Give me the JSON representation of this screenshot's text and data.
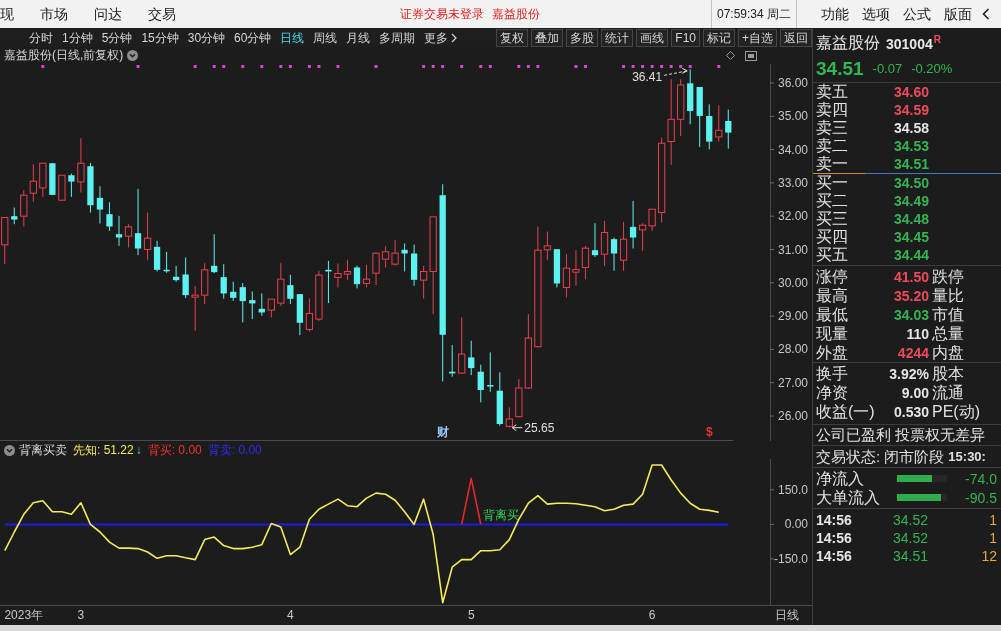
{
  "top_bar": {
    "menu": [
      "现",
      "市场",
      "问达",
      "交易"
    ],
    "notice": "证券交易未登录",
    "stock": "嘉益股份",
    "clock": "07:59:34 周二",
    "actions": [
      "功能",
      "选项",
      "公式",
      "版面"
    ]
  },
  "toolbar": {
    "period_tabs": [
      {
        "label": "分时",
        "selected": false
      },
      {
        "label": "1分钟",
        "selected": false
      },
      {
        "label": "5分钟",
        "selected": false
      },
      {
        "label": "15分钟",
        "selected": false
      },
      {
        "label": "30分钟",
        "selected": false
      },
      {
        "label": "60分钟",
        "selected": false
      },
      {
        "label": "日线",
        "selected": true
      },
      {
        "label": "周线",
        "selected": false
      },
      {
        "label": "月线",
        "selected": false
      },
      {
        "label": "多周期",
        "selected": false
      }
    ],
    "more": "更多",
    "tools": [
      "复权",
      "叠加",
      "多股",
      "统计",
      "画线",
      "F10",
      "标记",
      "+自选",
      "返回"
    ]
  },
  "chart": {
    "chart_data": [
      {
        "type": "candlestick",
        "title": "嘉益股份(日线,前复权)",
        "categories": [
          null,
          null,
          null,
          null,
          null,
          null,
          null,
          null,
          null,
          null,
          null,
          null,
          null,
          null,
          null,
          null,
          null,
          null,
          null,
          null,
          null,
          null,
          null,
          null,
          null,
          null,
          null,
          null,
          null,
          null,
          null,
          null,
          null,
          null,
          null,
          null,
          null,
          null,
          null,
          null,
          null,
          null,
          null,
          null,
          null,
          null,
          null,
          null,
          null,
          null,
          null,
          null,
          null,
          null,
          null,
          null,
          null,
          null,
          null,
          null,
          null,
          null,
          null,
          null,
          null,
          null,
          null,
          null,
          null,
          null,
          null,
          null,
          null,
          null,
          null,
          null,
          null
        ],
        "ohlc": [
          [
            31.14,
            31.96,
            30.56,
            31.96
          ],
          [
            32.0,
            32.26,
            31.76,
            31.9
          ],
          [
            32.0,
            32.78,
            31.69,
            32.63
          ],
          [
            32.69,
            33.56,
            32.44,
            33.05
          ],
          [
            32.85,
            33.59,
            32.58,
            33.59
          ],
          [
            33.59,
            33.59,
            32.64,
            32.64
          ],
          [
            32.48,
            33.23,
            32.48,
            33.23
          ],
          [
            33.23,
            33.28,
            32.58,
            33.04
          ],
          [
            33.03,
            34.34,
            32.71,
            33.59
          ],
          [
            33.5,
            33.6,
            32.11,
            32.33
          ],
          [
            32.55,
            32.9,
            31.78,
            32.2
          ],
          [
            32.06,
            32.42,
            31.56,
            31.69
          ],
          [
            31.46,
            32.01,
            31.11,
            31.36
          ],
          [
            31.4,
            31.76,
            31.06,
            31.68
          ],
          [
            31.49,
            32.82,
            30.83,
            31.03
          ],
          [
            31.0,
            32.11,
            30.69,
            31.34
          ],
          [
            31.08,
            31.26,
            30.34,
            30.39
          ],
          [
            30.39,
            30.93,
            30.3,
            30.35
          ],
          [
            30.18,
            30.51,
            30.03,
            30.08
          ],
          [
            30.25,
            30.76,
            29.54,
            29.63
          ],
          [
            29.57,
            29.9,
            28.56,
            29.63
          ],
          [
            29.63,
            30.59,
            29.36,
            30.39
          ],
          [
            30.51,
            31.46,
            30.29,
            30.32
          ],
          [
            30.17,
            30.56,
            29.52,
            29.68
          ],
          [
            29.73,
            30.03,
            29.46,
            29.55
          ],
          [
            29.87,
            29.99,
            28.81,
            29.45
          ],
          [
            29.48,
            29.74,
            28.91,
            29.38
          ],
          [
            29.22,
            29.68,
            29.01,
            29.11
          ],
          [
            29.18,
            29.51,
            28.96,
            29.51
          ],
          [
            29.39,
            30.59,
            29.31,
            30.11
          ],
          [
            29.93,
            30.24,
            29.36,
            29.52
          ],
          [
            29.66,
            29.66,
            28.43,
            28.8
          ],
          [
            28.6,
            29.53,
            28.54,
            29.08
          ],
          [
            28.91,
            30.36,
            28.86,
            30.23
          ],
          [
            30.39,
            30.66,
            29.39,
            30.34
          ],
          [
            30.16,
            30.58,
            29.86,
            30.28
          ],
          [
            30.26,
            30.69,
            30.09,
            30.34
          ],
          [
            30.46,
            30.51,
            29.83,
            29.96
          ],
          [
            29.98,
            30.54,
            29.86,
            30.11
          ],
          [
            30.29,
            30.91,
            29.93,
            30.89
          ],
          [
            30.71,
            31.09,
            30.46,
            30.93
          ],
          [
            30.56,
            31.29,
            30.51,
            30.89
          ],
          [
            30.99,
            31.18,
            30.34,
            30.88
          ],
          [
            30.88,
            31.15,
            29.91,
            30.09
          ],
          [
            30.08,
            30.51,
            29.53,
            30.34
          ],
          [
            30.34,
            31.98,
            29.06,
            31.98
          ],
          [
            32.63,
            32.96,
            27.04,
            28.44
          ],
          [
            27.33,
            28.13,
            27.18,
            27.28
          ],
          [
            27.29,
            28.96,
            27.26,
            27.86
          ],
          [
            27.76,
            28.26,
            27.23,
            27.44
          ],
          [
            27.33,
            27.54,
            26.41,
            26.78
          ],
          [
            26.93,
            27.91,
            26.73,
            26.89
          ],
          [
            26.76,
            27.31,
            25.71,
            25.76
          ],
          [
            25.69,
            26.26,
            25.65,
            25.91
          ],
          [
            25.98,
            27.11,
            25.96,
            26.84
          ],
          [
            26.84,
            29.06,
            26.81,
            28.34
          ],
          [
            28.08,
            31.69,
            28.06,
            30.98
          ],
          [
            30.99,
            31.54,
            30.68,
            31.11
          ],
          [
            31.01,
            31.01,
            29.86,
            29.98
          ],
          [
            29.86,
            30.86,
            29.56,
            30.44
          ],
          [
            30.32,
            30.98,
            29.91,
            30.4
          ],
          [
            30.46,
            31.11,
            30.11,
            31.04
          ],
          [
            30.98,
            31.79,
            30.78,
            30.83
          ],
          [
            30.86,
            31.86,
            30.51,
            31.51
          ],
          [
            31.31,
            31.36,
            30.36,
            30.88
          ],
          [
            30.68,
            31.83,
            30.36,
            31.31
          ],
          [
            31.68,
            32.46,
            31.03,
            31.36
          ],
          [
            31.59,
            31.79,
            30.96,
            31.73
          ],
          [
            31.71,
            32.21,
            31.56,
            32.21
          ],
          [
            32.11,
            34.36,
            31.81,
            34.19
          ],
          [
            34.24,
            36.11,
            33.54,
            34.91
          ],
          [
            34.91,
            36.11,
            34.41,
            35.94
          ],
          [
            35.99,
            36.41,
            34.76,
            35.16
          ],
          [
            35.88,
            35.88,
            34.08,
            35.01
          ],
          [
            35.01,
            35.36,
            34.01,
            34.24
          ],
          [
            34.38,
            35.33,
            34.24,
            34.58
          ],
          [
            34.86,
            35.2,
            34.03,
            34.51
          ]
        ],
        "ylim": [
          25.25,
          36.57
        ],
        "yticks": [
          {
            "value": 36,
            "label": "36.00"
          },
          {
            "value": 35,
            "label": "35.00"
          },
          {
            "value": 34,
            "label": "34.00"
          },
          {
            "value": 33,
            "label": "33.00"
          },
          {
            "value": 32,
            "label": "32.00"
          },
          {
            "value": 31,
            "label": "31.00"
          },
          {
            "value": 30,
            "label": "30.00"
          },
          {
            "value": 29,
            "label": "29.00"
          },
          {
            "value": 28,
            "label": "28.00"
          },
          {
            "value": 27,
            "label": "27.00"
          },
          {
            "value": 26,
            "label": "26.00"
          }
        ],
        "annotations": [
          "36.41",
          "25.65",
          "财",
          "$"
        ]
      },
      {
        "type": "line",
        "title": "背离买卖",
        "categories": [
          null,
          null,
          "2023年",
          null,
          null,
          null,
          null,
          null,
          "3",
          null,
          null,
          null,
          null,
          null,
          null,
          null,
          null,
          null,
          null,
          null,
          null,
          null,
          null,
          null,
          null,
          null,
          null,
          null,
          null,
          null,
          "4",
          null,
          null,
          null,
          null,
          null,
          null,
          null,
          null,
          null,
          null,
          null,
          null,
          null,
          null,
          null,
          null,
          null,
          null,
          "5",
          null,
          null,
          null,
          null,
          null,
          null,
          null,
          null,
          null,
          null,
          null,
          null,
          null,
          null,
          null,
          null,
          null,
          null,
          "6",
          null,
          null,
          null,
          null,
          null,
          null,
          null,
          null
        ],
        "series": [
          {
            "color": "#f3eb5c",
            "values": [
              -114,
              -33,
              44,
              94,
              103,
              55,
              55,
              44,
              94,
              0,
              -33,
              -77,
              -103,
              -103,
              -105,
              -120,
              -147,
              -136,
              -136,
              -145,
              -153,
              -66,
              -55,
              -92,
              -105,
              -105,
              -99,
              -88,
              4,
              -11,
              -131,
              -99,
              22,
              66,
              88,
              110,
              81,
              77,
              114,
              136,
              131,
              105,
              55,
              0,
              110,
              -44,
              -340,
              -186,
              -153,
              -153,
              -114,
              -114,
              -110,
              -66,
              22,
              92,
              125,
              88,
              92,
              92,
              90,
              83,
              77,
              59,
              66,
              83,
              88,
              131,
              258,
              258,
              193,
              136,
              92,
              66,
              61,
              53,
              null
            ]
          },
          {
            "color": "#e8262b",
            "values": [
              null,
              null,
              null,
              null,
              null,
              null,
              null,
              null,
              null,
              null,
              null,
              null,
              null,
              null,
              null,
              null,
              null,
              null,
              null,
              null,
              null,
              null,
              null,
              null,
              null,
              null,
              null,
              null,
              null,
              null,
              null,
              null,
              null,
              null,
              null,
              null,
              null,
              null,
              null,
              null,
              null,
              null,
              null,
              null,
              null,
              null,
              null,
              null,
              0,
              200,
              0,
              null,
              null,
              null,
              null,
              null,
              null,
              null,
              null,
              null,
              null,
              null,
              null,
              null,
              null,
              null,
              null,
              null,
              null,
              null,
              null,
              null,
              null,
              null,
              null,
              null,
              null
            ]
          }
        ],
        "ylim": [
          -350,
          284
        ],
        "yticks": [
          {
            "value": 150,
            "label": "150.0"
          },
          {
            "value": 0,
            "label": "0.00"
          },
          {
            "value": -150,
            "label": "-150.0"
          }
        ],
        "ref_lines": [
          {
            "axis": "y",
            "value": 0,
            "color": "#1a1ae6"
          }
        ],
        "annotations": [
          "背离买"
        ]
      }
    ],
    "indicator_readings": [
      {
        "text": "先知: 51.22",
        "color": "#f3eb5c",
        "trend": "↓"
      },
      {
        "text": "背买: 0.00",
        "color": "#f03030"
      },
      {
        "text": "背卖: 0.00",
        "color": "#2d2df5"
      }
    ],
    "period_label": "日线"
  },
  "quote": {
    "name": "嘉益股份",
    "code": "301004",
    "suffix": "R",
    "price": "34.51",
    "change": "-0.07",
    "change_pct": "-0.20%",
    "asks": [
      {
        "label": "卖五",
        "price": "34.60",
        "color": "#f04a5c"
      },
      {
        "label": "卖四",
        "price": "34.59",
        "color": "#f04a5c"
      },
      {
        "label": "卖三",
        "price": "34.58",
        "color": "#e6e6e6"
      },
      {
        "label": "卖二",
        "price": "34.53",
        "color": "#33b552"
      },
      {
        "label": "卖一",
        "price": "34.51",
        "color": "#33b552"
      }
    ],
    "bids": [
      {
        "label": "买一",
        "price": "34.50",
        "color": "#33b552"
      },
      {
        "label": "买二",
        "price": "34.49",
        "color": "#33b552"
      },
      {
        "label": "买三",
        "price": "34.48",
        "color": "#33b552"
      },
      {
        "label": "买四",
        "price": "34.45",
        "color": "#33b552"
      },
      {
        "label": "买五",
        "price": "34.44",
        "color": "#33b552"
      }
    ],
    "stats": [
      {
        "label": "涨停",
        "value": "41.50",
        "color": "#f04a5c",
        "label2": "跌停"
      },
      {
        "label": "最高",
        "value": "35.20",
        "color": "#f04a5c",
        "label2": "量比"
      },
      {
        "label": "最低",
        "value": "34.03",
        "color": "#33b552",
        "label2": "市值"
      },
      {
        "label": "现量",
        "value": "110",
        "color": "#e6e6e6",
        "label2": "总量"
      },
      {
        "label": "外盘",
        "value": "4244",
        "color": "#f04a5c",
        "label2": "内盘"
      }
    ],
    "ratios": [
      {
        "label": "换手",
        "value": "3.92%",
        "label2": "股本"
      },
      {
        "label": "净资",
        "value": "9.00",
        "label2": "流通"
      },
      {
        "label": "收益(一)",
        "value": "0.530",
        "label2": "PE(动)"
      }
    ],
    "note": "公司已盈利 投票权无差异",
    "status": {
      "label": "交易状态: 闭市阶段",
      "time": "15:30:"
    },
    "flows": [
      {
        "label": "净流入",
        "level": 0.7,
        "value": "-74.0"
      },
      {
        "label": "大单流入",
        "level": 0.88,
        "value": "-90.5"
      }
    ],
    "ticks": [
      {
        "time": "14:56",
        "price": "34.52",
        "volume": "1"
      },
      {
        "time": "14:56",
        "price": "34.52",
        "volume": "1"
      },
      {
        "time": "14:56",
        "price": "34.51",
        "volume": "12"
      }
    ]
  }
}
